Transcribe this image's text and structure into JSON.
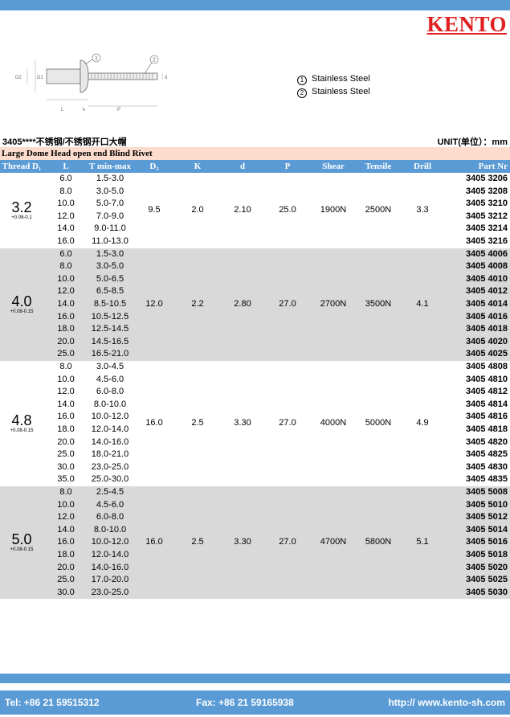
{
  "brand": "KENTO",
  "legend": [
    {
      "num": "1",
      "text": "Stainless Steel"
    },
    {
      "num": "2",
      "text": "Stainless Steel"
    }
  ],
  "diagram_labels": {
    "d2": "D2",
    "d1": "D1",
    "d": "d",
    "l": "L",
    "k": "k",
    "p": "P",
    "n1": "1",
    "n2": "2"
  },
  "code_line": "3405****不锈钢/不锈钢开口大帽",
  "unit_line": "UNIT(单位）：mm",
  "subtitle": "Large Dome Head open end Blind Rivet",
  "headers": {
    "thread": "Thread D₁",
    "l": "L",
    "t": "T min-max",
    "d2": "D₂",
    "k": "K",
    "d": "d",
    "p": "P",
    "shear": "Shear",
    "tensile": "Tensile",
    "drill": "Drill",
    "part": "Part Nr"
  },
  "groups": [
    {
      "size": "3.2",
      "tol": "+0.08-0.1",
      "d2": "9.5",
      "k": "2.0",
      "d": "2.10",
      "p": "25.0",
      "shear": "1900N",
      "tensile": "2500N",
      "drill": "3.3",
      "rows": [
        {
          "l": "6.0",
          "t": "1.5-3.0",
          "pn": "3405 3206"
        },
        {
          "l": "8.0",
          "t": "3.0-5.0",
          "pn": "3405 3208"
        },
        {
          "l": "10.0",
          "t": "5.0-7.0",
          "pn": "3405 3210"
        },
        {
          "l": "12.0",
          "t": "7.0-9.0",
          "pn": "3405 3212"
        },
        {
          "l": "14.0",
          "t": "9.0-11.0",
          "pn": "3405 3214"
        },
        {
          "l": "16.0",
          "t": "11.0-13.0",
          "pn": "3405 3216"
        }
      ]
    },
    {
      "size": "4.0",
      "tol": "+0.08-0.15",
      "d2": "12.0",
      "k": "2.2",
      "d": "2.80",
      "p": "27.0",
      "shear": "2700N",
      "tensile": "3500N",
      "drill": "4.1",
      "rows": [
        {
          "l": "6.0",
          "t": "1.5-3.0",
          "pn": "3405 4006"
        },
        {
          "l": "8.0",
          "t": "3.0-5.0",
          "pn": "3405 4008"
        },
        {
          "l": "10.0",
          "t": "5.0-6.5",
          "pn": "3405 4010"
        },
        {
          "l": "12.0",
          "t": "6.5-8.5",
          "pn": "3405 4012"
        },
        {
          "l": "14.0",
          "t": "8.5-10.5",
          "pn": "3405 4014"
        },
        {
          "l": "16.0",
          "t": "10.5-12.5",
          "pn": "3405 4016"
        },
        {
          "l": "18.0",
          "t": "12.5-14.5",
          "pn": "3405 4018"
        },
        {
          "l": "20.0",
          "t": "14.5-16.5",
          "pn": "3405 4020"
        },
        {
          "l": "25.0",
          "t": "16.5-21.0",
          "pn": "3405 4025"
        }
      ]
    },
    {
      "size": "4.8",
      "tol": "+0.08-0.15",
      "d2": "16.0",
      "k": "2.5",
      "d": "3.30",
      "p": "27.0",
      "shear": "4000N",
      "tensile": "5000N",
      "drill": "4.9",
      "rows": [
        {
          "l": "8.0",
          "t": "3.0-4.5",
          "pn": "3405 4808"
        },
        {
          "l": "10.0",
          "t": "4.5-6.0",
          "pn": "3405 4810"
        },
        {
          "l": "12.0",
          "t": "6.0-8.0",
          "pn": "3405 4812"
        },
        {
          "l": "14.0",
          "t": "8.0-10.0",
          "pn": "3405 4814"
        },
        {
          "l": "16.0",
          "t": "10.0-12.0",
          "pn": "3405 4816"
        },
        {
          "l": "18.0",
          "t": "12.0-14.0",
          "pn": "3405 4818"
        },
        {
          "l": "20.0",
          "t": "14.0-16.0",
          "pn": "3405 4820"
        },
        {
          "l": "25.0",
          "t": "18.0-21.0",
          "pn": "3405 4825"
        },
        {
          "l": "30.0",
          "t": "23.0-25.0",
          "pn": "3405 4830"
        },
        {
          "l": "35.0",
          "t": "25.0-30.0",
          "pn": "3405 4835"
        }
      ]
    },
    {
      "size": "5.0",
      "tol": "+0.08-0.15",
      "d2": "16.0",
      "k": "2.5",
      "d": "3.30",
      "p": "27.0",
      "shear": "4700N",
      "tensile": "5800N",
      "drill": "5.1",
      "rows": [
        {
          "l": "8.0",
          "t": "2.5-4.5",
          "pn": "3405 5008"
        },
        {
          "l": "10.0",
          "t": "4.5-6.0",
          "pn": "3405 5010"
        },
        {
          "l": "12.0",
          "t": "6.0-8.0",
          "pn": "3405 5012"
        },
        {
          "l": "14.0",
          "t": "8.0-10.0",
          "pn": "3405 5014"
        },
        {
          "l": "16.0",
          "t": "10.0-12.0",
          "pn": "3405 5016"
        },
        {
          "l": "18.0",
          "t": "12.0-14.0",
          "pn": "3405 5018"
        },
        {
          "l": "20.0",
          "t": "14.0-16.0",
          "pn": "3405 5020"
        },
        {
          "l": "25.0",
          "t": "17.0-20.0",
          "pn": "3405 5025"
        },
        {
          "l": "30.0",
          "t": "23.0-25.0",
          "pn": "3405 5030"
        }
      ]
    }
  ],
  "footer": {
    "tel": "Tel: +86 21 59515312",
    "fax": "Fax: +86 21 59165938",
    "web": "http:// www.kento-sh.com"
  },
  "colors": {
    "bar": "#5b9bd5",
    "subtitle_bg": "#fcdccc",
    "grey_band": "#d9d9d9",
    "brand": "#e02020"
  }
}
